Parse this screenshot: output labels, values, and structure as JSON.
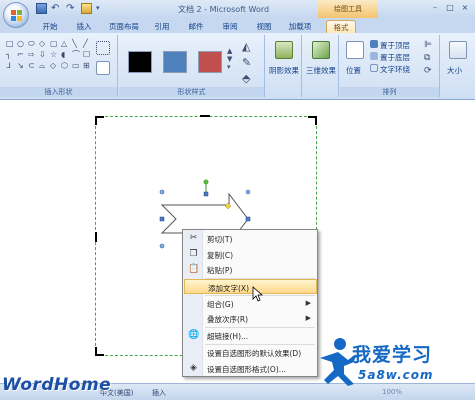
{
  "window": {
    "title": "文档 2 - Microsoft Word",
    "context_tool": "绘图工具",
    "controls": [
      "–",
      "□",
      "×"
    ]
  },
  "tabs": [
    {
      "label": "开始",
      "active": false
    },
    {
      "label": "插入",
      "active": false
    },
    {
      "label": "页面布局",
      "active": false
    },
    {
      "label": "引用",
      "active": false
    },
    {
      "label": "邮件",
      "active": false
    },
    {
      "label": "审阅",
      "active": false
    },
    {
      "label": "视图",
      "active": false
    },
    {
      "label": "加载项",
      "active": false
    },
    {
      "label": "格式",
      "active": true
    }
  ],
  "ribbon": {
    "insert_shapes_label": "插入形状",
    "shape_styles_label": "形状样式",
    "arrange_label": "排列",
    "shadow_effects": "阴影效果",
    "threed_effects": "三维效果",
    "position": "位置",
    "bring_to_front": "置于顶层",
    "send_to_back": "置于底层",
    "text_wrapping": "文字环绕",
    "size": "大小",
    "swatch_colors": [
      "#000000",
      "#4f81bd",
      "#c0504d"
    ],
    "shape_glyphs": [
      "□",
      "○",
      "⬭",
      "◇",
      "▢",
      "△",
      "╲",
      "╱",
      "┐",
      "⌐",
      "⇨",
      "⇩",
      "☆",
      "◖",
      "⌒",
      "☐",
      "ᒧ",
      "↘",
      "⊂",
      "⌓",
      "◇",
      "⬡",
      "▭",
      "⊞"
    ]
  },
  "context_menu": {
    "items": [
      {
        "label": "剪切(T)",
        "icon": "scissors-icon",
        "glyph": "✂",
        "submenu": false,
        "highlighted": false
      },
      {
        "label": "复制(C)",
        "icon": "copy-icon",
        "glyph": "❐",
        "submenu": false,
        "highlighted": false
      },
      {
        "label": "粘贴(P)",
        "icon": "paste-icon",
        "glyph": "📋",
        "submenu": false,
        "highlighted": false
      },
      {
        "label": "添加文字(X)",
        "icon": "",
        "glyph": "",
        "submenu": false,
        "highlighted": true
      },
      {
        "label": "组合(G)",
        "icon": "",
        "glyph": "",
        "submenu": true,
        "highlighted": false
      },
      {
        "label": "叠放次序(R)",
        "icon": "",
        "glyph": "",
        "submenu": true,
        "highlighted": false
      },
      {
        "label": "超链接(H)...",
        "icon": "hyperlink-icon",
        "glyph": "🌐",
        "submenu": false,
        "highlighted": false
      },
      {
        "label": "设置自选图形的默认效果(D)",
        "icon": "",
        "glyph": "",
        "submenu": false,
        "highlighted": false
      },
      {
        "label": "设置自选图形格式(O)...",
        "icon": "format-shape-icon",
        "glyph": "◈",
        "submenu": false,
        "highlighted": false
      }
    ]
  },
  "statusbar": {
    "brand": "WordHome",
    "language": "中文(美国)",
    "mode": "插入",
    "zoom": "100%"
  },
  "watermark": {
    "main": "我爱学习",
    "sub": "5a8w.com"
  }
}
